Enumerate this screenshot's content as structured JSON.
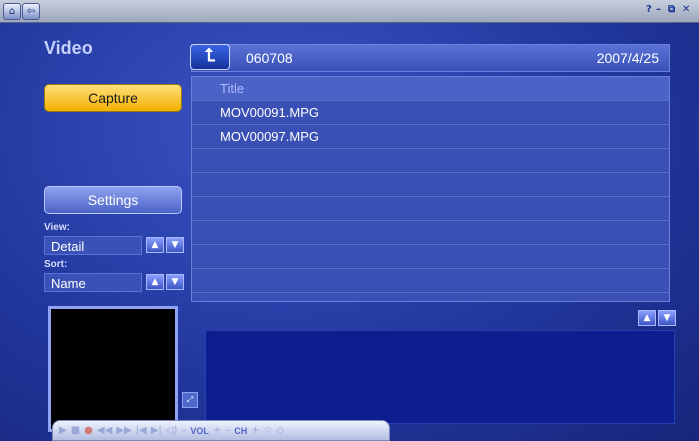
{
  "topbar": {
    "home_icon": "house",
    "back_icon": "arrow-left",
    "help": "?",
    "minimize": "–",
    "restore": "⧉",
    "close": "✕"
  },
  "page": {
    "title": "Video"
  },
  "sidebar": {
    "capture_label": "Capture",
    "settings_label": "Settings",
    "view_label": "View:",
    "view_value": "Detail",
    "sort_label": "Sort:",
    "sort_value": "Name"
  },
  "path": {
    "folder": "060708",
    "date": "2007/4/25"
  },
  "list": {
    "header": "Title",
    "rows": [
      "MOV00091.MPG",
      "MOV00097.MPG",
      "",
      "",
      "",
      "",
      "",
      ""
    ]
  },
  "media_bar": {
    "vol_label": "VOL",
    "ch_label": "CH"
  }
}
